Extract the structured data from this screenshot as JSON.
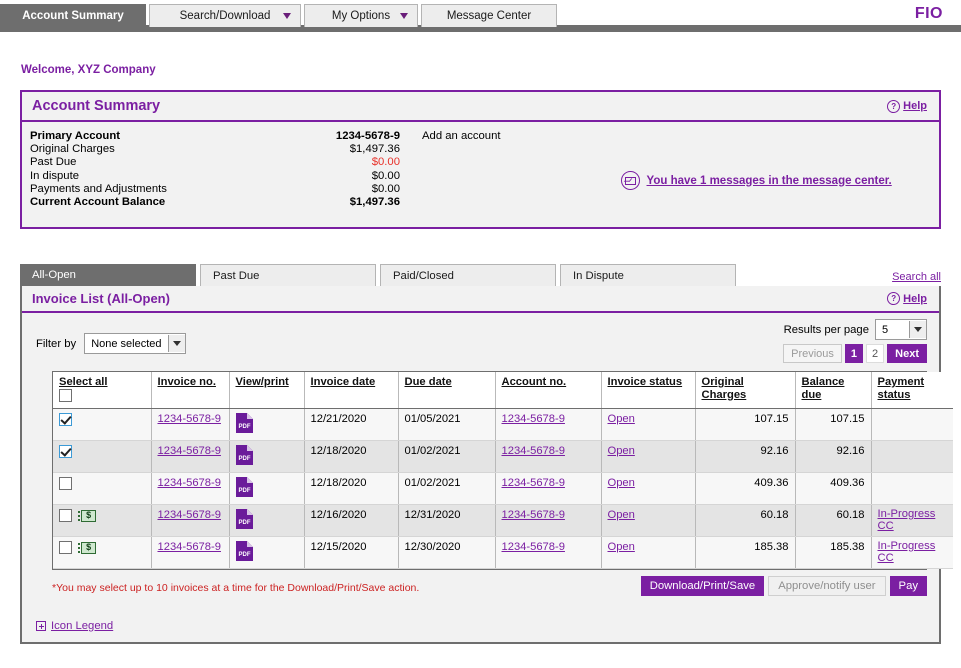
{
  "brand": "FIO",
  "top_nav": {
    "tabs": [
      {
        "label": "Account Summary",
        "active": true,
        "caret": false
      },
      {
        "label": "Search/Download",
        "active": false,
        "caret": true
      },
      {
        "label": "My Options",
        "active": false,
        "caret": true
      },
      {
        "label": "Message Center",
        "active": false,
        "caret": false
      }
    ]
  },
  "welcome": "Welcome, XYZ Company",
  "account_summary": {
    "title": "Account Summary",
    "help_label": "Help",
    "help_icon": "question-circle-icon",
    "rows": [
      {
        "label": "Primary Account",
        "value": "1234-5678-9",
        "bold": true,
        "red": false
      },
      {
        "label": "Original Charges",
        "value": "$1,497.36",
        "bold": false,
        "red": false
      },
      {
        "label": "Past Due",
        "value": "$0.00",
        "bold": false,
        "red": true
      },
      {
        "label": "In dispute",
        "value": "$0.00",
        "bold": false,
        "red": false
      },
      {
        "label": "Payments and Adjustments",
        "value": "$0.00",
        "bold": false,
        "red": false
      },
      {
        "label": "Current Account Balance",
        "value": "$1,497.36",
        "bold": true,
        "red": false
      }
    ],
    "add_account": "Add an account",
    "message_icon": "envelope-icon",
    "message_link": "You have 1 messages in the message center."
  },
  "invoice_tabs": {
    "tabs": [
      {
        "label": "All-Open",
        "active": true
      },
      {
        "label": "Past Due",
        "active": false
      },
      {
        "label": "Paid/Closed",
        "active": false
      },
      {
        "label": "In Dispute",
        "active": false
      }
    ],
    "search_all": "Search all"
  },
  "invoice_panel": {
    "title": "Invoice List (All-Open)",
    "help_label": "Help",
    "help_icon": "question-circle-icon",
    "filter": {
      "label": "Filter by",
      "selected": "None selected",
      "caret_icon": "chevron-down-icon"
    },
    "results_per_page": {
      "label": "Results per page",
      "selected": "5",
      "caret_icon": "chevron-down-icon"
    },
    "pager": {
      "previous": "Previous",
      "pages": [
        "1",
        "2"
      ],
      "current_page": "1",
      "next": "Next"
    },
    "columns": [
      "Select all",
      "Invoice no.",
      "View/print",
      "Invoice date",
      "Due date",
      "Account no.",
      "Invoice status",
      "Original Charges",
      "Balance due",
      "Payment status"
    ],
    "rows": [
      {
        "selected": true,
        "money_icon": false,
        "invoice_no": "1234-5678-9",
        "view_print_icon": "pdf-icon",
        "invoice_date": "12/21/2020",
        "due_date": "01/05/2021",
        "account_no": "1234-5678-9",
        "invoice_status": "Open",
        "original_charges": "107.15",
        "balance_due": "107.15",
        "payment_status": ""
      },
      {
        "selected": true,
        "money_icon": false,
        "invoice_no": "1234-5678-9",
        "view_print_icon": "pdf-icon",
        "invoice_date": "12/18/2020",
        "due_date": "01/02/2021",
        "account_no": "1234-5678-9",
        "invoice_status": "Open",
        "original_charges": "92.16",
        "balance_due": "92.16",
        "payment_status": ""
      },
      {
        "selected": false,
        "money_icon": false,
        "invoice_no": "1234-5678-9",
        "view_print_icon": "pdf-icon",
        "invoice_date": "12/18/2020",
        "due_date": "01/02/2021",
        "account_no": "1234-5678-9",
        "invoice_status": "Open",
        "original_charges": "409.36",
        "balance_due": "409.36",
        "payment_status": ""
      },
      {
        "selected": false,
        "money_icon": true,
        "invoice_no": "1234-5678-9",
        "view_print_icon": "pdf-icon",
        "invoice_date": "12/16/2020",
        "due_date": "12/31/2020",
        "account_no": "1234-5678-9",
        "invoice_status": "Open",
        "original_charges": "60.18",
        "balance_due": "60.18",
        "payment_status": "In-Progress CC"
      },
      {
        "selected": false,
        "money_icon": true,
        "invoice_no": "1234-5678-9",
        "view_print_icon": "pdf-icon",
        "invoice_date": "12/15/2020",
        "due_date": "12/30/2020",
        "account_no": "1234-5678-9",
        "invoice_status": "Open",
        "original_charges": "185.38",
        "balance_due": "185.38",
        "payment_status": "In-Progress CC"
      }
    ],
    "footnote": "*You may select up to 10 invoices at a time for the Download/Print/Save action.",
    "buttons": {
      "download": "Download/Print/Save",
      "approve": "Approve/notify user",
      "pay": "Pay"
    },
    "icon_legend": "Icon Legend",
    "icon_legend_expander": "plus-box-icon"
  },
  "colors": {
    "brand_purple": "#7b1fa2",
    "nav_gray": "#6e6e6e",
    "alert_red": "#e8322a",
    "footnote_red": "#cc2222"
  }
}
